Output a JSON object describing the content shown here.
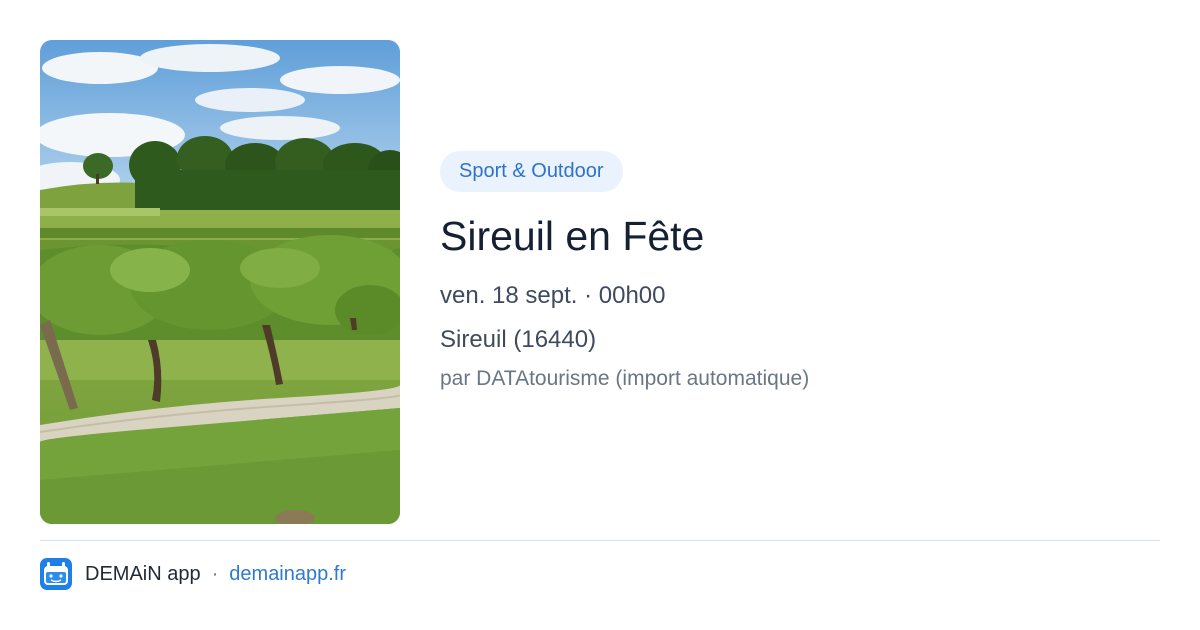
{
  "event": {
    "category": "Sport & Outdoor",
    "title": "Sireuil en Fête",
    "date": "ven. 18 sept. · 00h00",
    "location": "Sireuil (16440)",
    "organizer": "par DATAtourisme (import automatique)"
  },
  "footer": {
    "app_name": "DEMAiN app",
    "separator": "·",
    "domain": "demainapp.fr"
  },
  "colors": {
    "accent": "#2f72c9",
    "badge_background": "#eaf3fd",
    "title_text": "#152033",
    "muted_text": "#6a7685"
  },
  "icons": {
    "app_logo": "demain-app-icon"
  }
}
